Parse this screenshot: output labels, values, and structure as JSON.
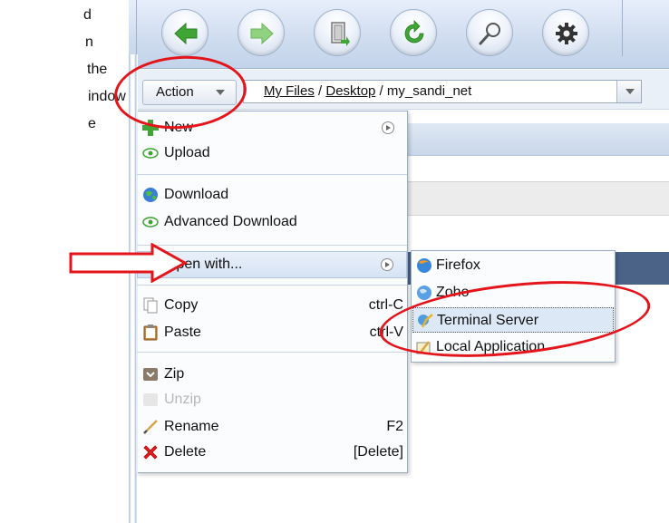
{
  "instruction_fragments": [
    "d",
    "n",
    "the",
    "indow",
    "e"
  ],
  "toolbar": {
    "icons": [
      "back-arrow-icon",
      "forward-arrow-icon",
      "save-door-icon",
      "refresh-icon",
      "search-magnifier-icon",
      "settings-gear-icon"
    ]
  },
  "action_button": {
    "label": "Action"
  },
  "breadcrumb": {
    "root": "My Files",
    "sep1": " / ",
    "folder": "Desktop",
    "sep2": " / ",
    "current": "my_sandi_net"
  },
  "menu": {
    "items": [
      {
        "label": "New",
        "icon": "plus-icon",
        "submenu": true
      },
      {
        "label": "Upload",
        "icon": "upload-eye-icon"
      },
      {
        "label": "Download",
        "icon": "globe-download-icon"
      },
      {
        "label": "Advanced Download",
        "icon": "eye-icon"
      },
      {
        "label": "Open with...",
        "icon": "eye-icon",
        "submenu": true,
        "highlighted": true
      },
      {
        "label": "Copy",
        "icon": "copy-icon",
        "shortcut": "ctrl-C"
      },
      {
        "label": "Paste",
        "icon": "paste-icon",
        "shortcut": "ctrl-V"
      },
      {
        "label": "Zip",
        "icon": "zip-icon"
      },
      {
        "label": "Unzip",
        "icon": "unzip-icon",
        "disabled": true
      },
      {
        "label": "Rename",
        "icon": "pencil-icon",
        "shortcut": "F2"
      },
      {
        "label": "Delete",
        "icon": "red-x-icon",
        "shortcut": "[Delete]"
      }
    ]
  },
  "submenu": {
    "items": [
      {
        "label": "Firefox",
        "icon": "firefox-globe-icon"
      },
      {
        "label": "Zoho",
        "icon": "zoho-globe-icon"
      },
      {
        "label": "Terminal Server",
        "icon": "terminal-server-icon",
        "highlighted": true
      },
      {
        "label": "Local Application",
        "icon": "local-app-icon"
      }
    ]
  },
  "colors": {
    "annotation_red": "#e4141b",
    "toolbar_green": "#3fa535",
    "highlight_blue": "#d6e3f4",
    "dark_panel": "#4a6387"
  }
}
